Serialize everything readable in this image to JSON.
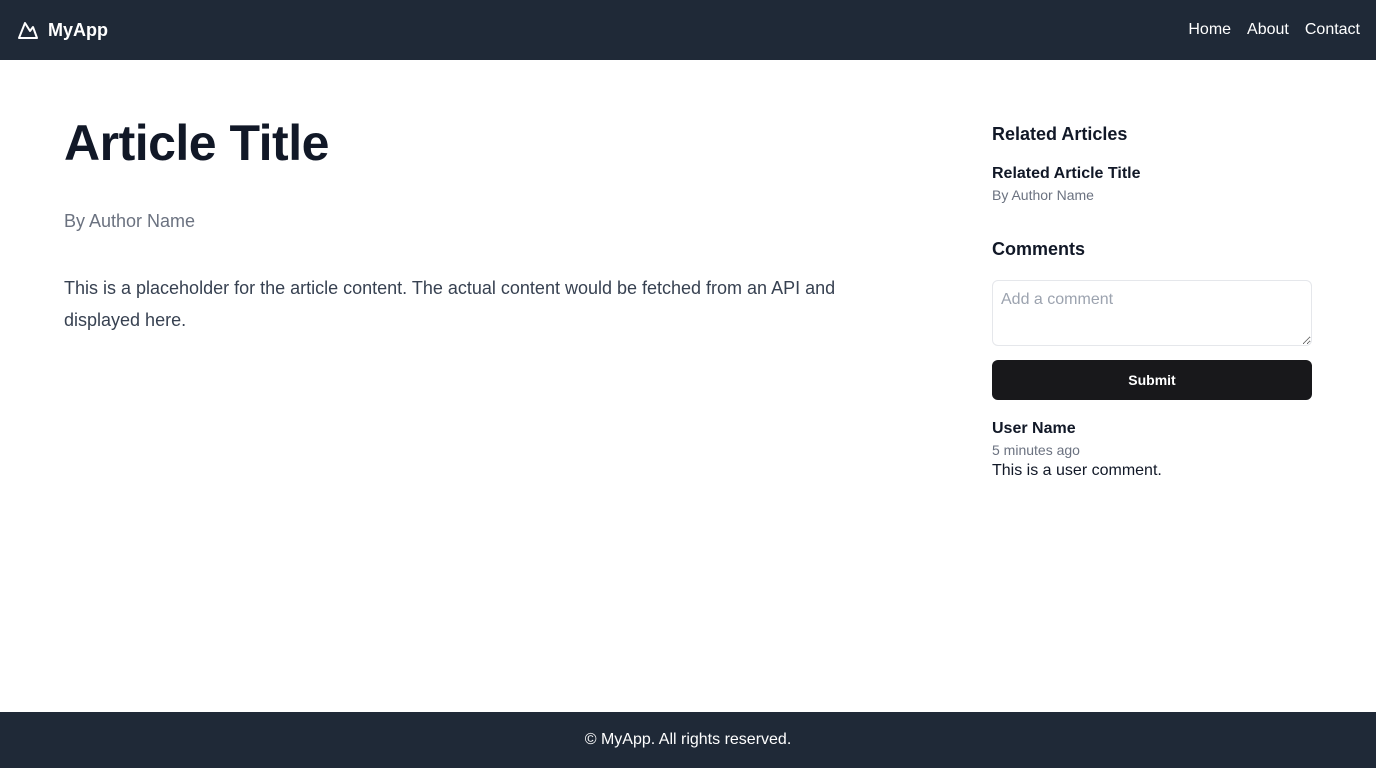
{
  "header": {
    "brand": "MyApp",
    "brand_icon": "mountain-icon",
    "nav": [
      {
        "label": "Home"
      },
      {
        "label": "About"
      },
      {
        "label": "Contact"
      }
    ]
  },
  "article": {
    "title": "Article Title",
    "author": "By Author Name",
    "body": "This is a placeholder for the article content. The actual content would be fetched from an API and displayed here."
  },
  "sidebar": {
    "related": {
      "title": "Related Articles",
      "items": [
        {
          "title": "Related Article Title",
          "author": "By Author Name"
        }
      ]
    },
    "comments": {
      "title": "Comments",
      "input_placeholder": "Add a comment",
      "input_value": "",
      "submit_label": "Submit",
      "items": [
        {
          "user": "User Name",
          "time": "5 minutes ago",
          "text": "This is a user comment."
        }
      ]
    }
  },
  "footer": {
    "text": "© MyApp. All rights reserved."
  },
  "colors": {
    "header_bg": "#1f2937",
    "footer_bg": "#1f2937",
    "button_bg": "#18181b",
    "muted_text": "#6b7280"
  }
}
